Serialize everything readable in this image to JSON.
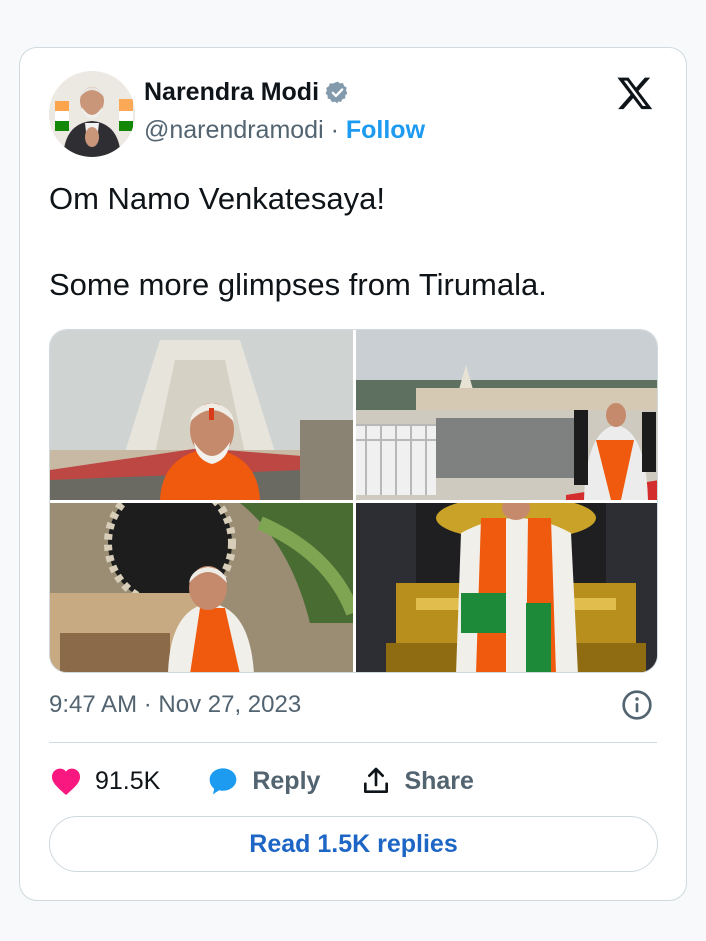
{
  "author": {
    "name": "Narendra Modi",
    "handle": "@narendramodi",
    "separator": "·",
    "follow_label": "Follow"
  },
  "tweet": {
    "line1": "Om Namo Venkatesaya!",
    "line2": "Some more glimpses from Tirumala.",
    "time": "9:47 AM",
    "date_sep": "·",
    "date": "Nov 27, 2023"
  },
  "actions": {
    "likes": "91.5K",
    "reply_label": "Reply",
    "share_label": "Share"
  },
  "read_replies_label": "Read 1.5K replies",
  "icons": {
    "verified": "verified-badge-icon",
    "x_logo": "x-logo-icon",
    "info": "info-icon",
    "like": "heart-icon",
    "reply": "speech-bubble-icon",
    "share": "share-upload-icon"
  },
  "colors": {
    "accent": "#1d9bf0",
    "like": "#f91880",
    "link": "#1d66c5"
  }
}
